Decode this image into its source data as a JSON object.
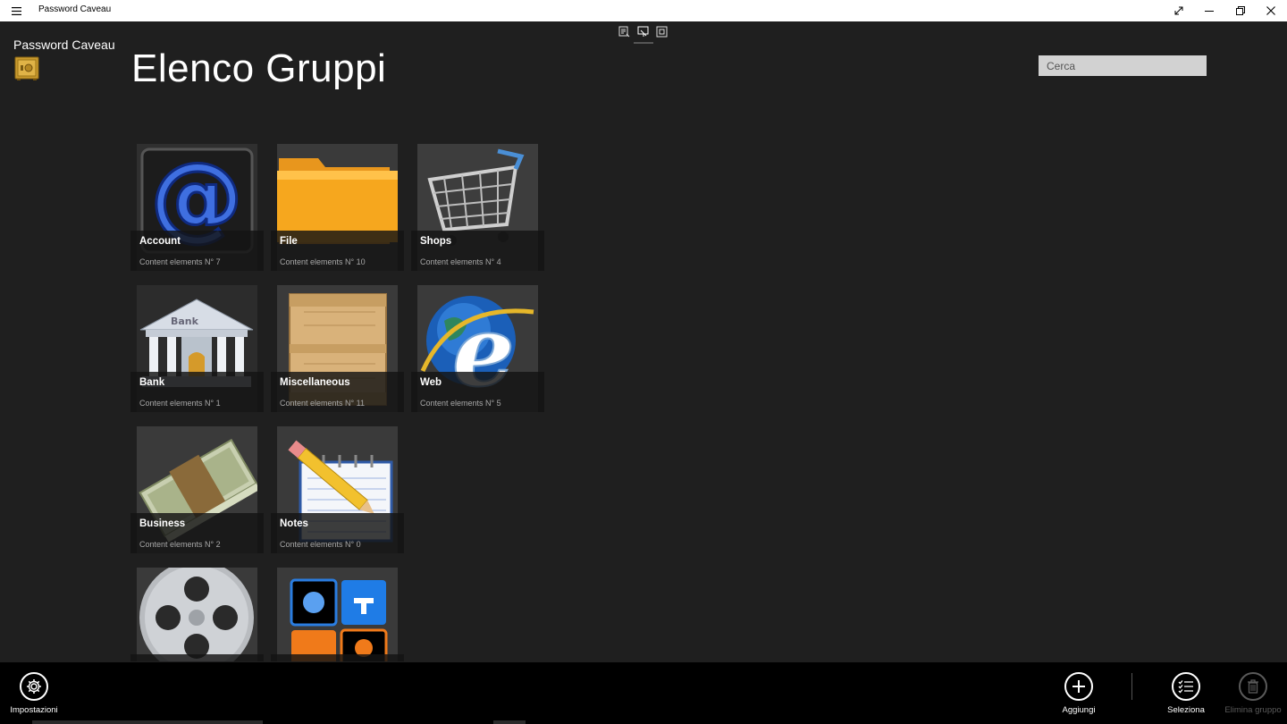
{
  "window": {
    "title": "Password Caveau",
    "menu_icon": "hamburger-icon",
    "controls": [
      "fullscreen-icon",
      "minimize-icon",
      "restore-icon",
      "close-icon"
    ]
  },
  "top_tools": [
    "dock-icon",
    "screen-share-icon",
    "frame-icon"
  ],
  "header": {
    "app_name": "Password Caveau",
    "page_title": "Elenco Gruppi",
    "logo_icon": "safe-icon"
  },
  "search": {
    "placeholder": "Cerca"
  },
  "groups": [
    {
      "name": "Account",
      "count": "Content elements N° 7",
      "icon": "email-at-icon"
    },
    {
      "name": "File",
      "count": "Content elements N° 10",
      "icon": "folder-icon"
    },
    {
      "name": "Shops",
      "count": "Content elements N° 4",
      "icon": "shopping-cart-icon"
    },
    {
      "name": "Bank",
      "count": "Content elements N° 1",
      "icon": "bank-building-icon"
    },
    {
      "name": "Miscellaneous",
      "count": "Content elements N° 11",
      "icon": "wooden-crate-icon"
    },
    {
      "name": "Web",
      "count": "Content elements N° 5",
      "icon": "internet-explorer-globe-icon"
    },
    {
      "name": "Business",
      "count": "Content elements N° 2",
      "icon": "money-stack-icon"
    },
    {
      "name": "Notes",
      "count": "Content elements N° 0",
      "icon": "notepad-pencil-icon"
    },
    {
      "name": "",
      "count": "",
      "icon": "film-reel-icon"
    },
    {
      "name": "",
      "count": "",
      "icon": "utilities-icon"
    }
  ],
  "appbar": {
    "settings_label": "Impostazioni",
    "add_label": "Aggiungi",
    "select_label": "Seleziona",
    "delete_label": "Elimina gruppo"
  },
  "colors": {
    "background": "#1f1f1f",
    "appbar": "#000000",
    "search_bg": "#d2d2d2",
    "tile_band": "#141414"
  }
}
